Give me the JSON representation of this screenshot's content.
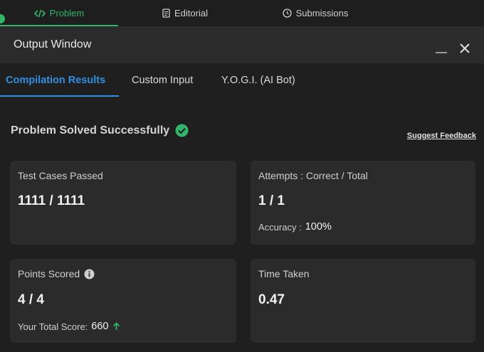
{
  "top_tabs": [
    {
      "label": "Problem",
      "icon": "code-icon",
      "active": true
    },
    {
      "label": "Editorial",
      "icon": "document-icon",
      "active": false
    },
    {
      "label": "Submissions",
      "icon": "clock-icon",
      "active": false
    }
  ],
  "output_window": {
    "title": "Output Window"
  },
  "sub_tabs": [
    {
      "label": "Compilation Results",
      "active": true
    },
    {
      "label": "Custom Input",
      "active": false
    },
    {
      "label": "Y.O.G.I. (AI Bot)",
      "active": false
    }
  ],
  "status": {
    "text": "Problem Solved Successfully",
    "feedback_link": "Suggest Feedback"
  },
  "cards": {
    "test_cases": {
      "label": "Test Cases Passed",
      "value": "1111 / 1111"
    },
    "attempts": {
      "label": "Attempts : Correct / Total",
      "value": "1 / 1",
      "accuracy_label": "Accuracy :",
      "accuracy_value": "100%"
    },
    "points": {
      "label": "Points Scored",
      "value": "4 / 4",
      "total_label": "Your Total Score:",
      "total_value": "660"
    },
    "time": {
      "label": "Time Taken",
      "value": "0.47"
    }
  },
  "colors": {
    "accent_green": "#2fb66a",
    "accent_blue": "#2f8fe0",
    "background": "#1f1f1f",
    "card": "#2b2b2b"
  }
}
